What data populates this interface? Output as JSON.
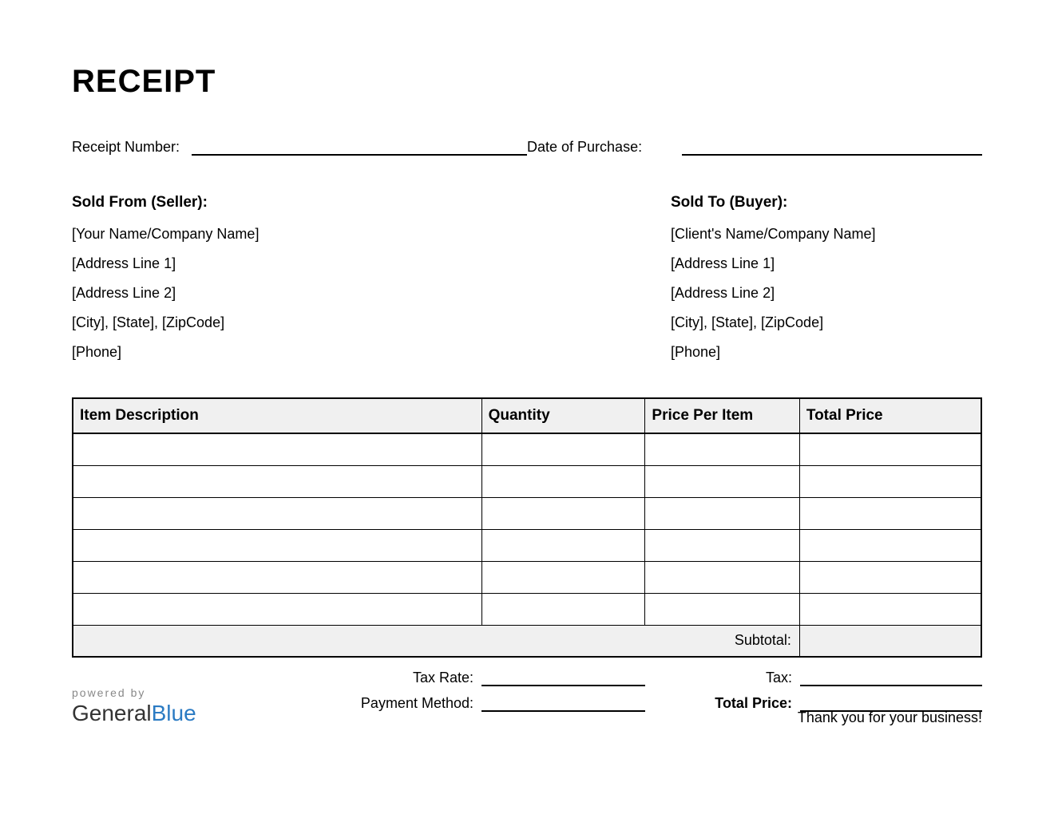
{
  "title": "RECEIPT",
  "meta": {
    "receipt_number_label": "Receipt Number:",
    "receipt_number_value": "",
    "date_label": "Date of Purchase:",
    "date_value": ""
  },
  "seller": {
    "header": "Sold From (Seller):",
    "name": "[Your Name/Company Name]",
    "address1": "[Address Line 1]",
    "address2": "[Address Line 2]",
    "city_state_zip": "[City], [State], [ZipCode]",
    "phone": "[Phone]"
  },
  "buyer": {
    "header": "Sold To (Buyer):",
    "name": "[Client's Name/Company Name]",
    "address1": "[Address Line 1]",
    "address2": "[Address Line 2]",
    "city_state_zip": "[City], [State], [ZipCode]",
    "phone": "[Phone]"
  },
  "table": {
    "headers": {
      "description": "Item Description",
      "quantity": "Quantity",
      "price_per_item": "Price Per Item",
      "total_price": "Total Price"
    },
    "rows": [
      {
        "description": "",
        "quantity": "",
        "price_per_item": "",
        "total_price": ""
      },
      {
        "description": "",
        "quantity": "",
        "price_per_item": "",
        "total_price": ""
      },
      {
        "description": "",
        "quantity": "",
        "price_per_item": "",
        "total_price": ""
      },
      {
        "description": "",
        "quantity": "",
        "price_per_item": "",
        "total_price": ""
      },
      {
        "description": "",
        "quantity": "",
        "price_per_item": "",
        "total_price": ""
      },
      {
        "description": "",
        "quantity": "",
        "price_per_item": "",
        "total_price": ""
      }
    ],
    "subtotal_label": "Subtotal:",
    "subtotal_value": ""
  },
  "summary": {
    "tax_rate_label": "Tax Rate:",
    "tax_rate_value": "",
    "tax_label": "Tax:",
    "tax_value": "",
    "payment_method_label": "Payment Method:",
    "payment_method_value": "",
    "total_price_label": "Total Price:",
    "total_price_value": ""
  },
  "footer": {
    "powered_by": "powered by",
    "logo_part1": "General",
    "logo_part2": "Blue",
    "thank_you": "Thank you for your business!"
  }
}
